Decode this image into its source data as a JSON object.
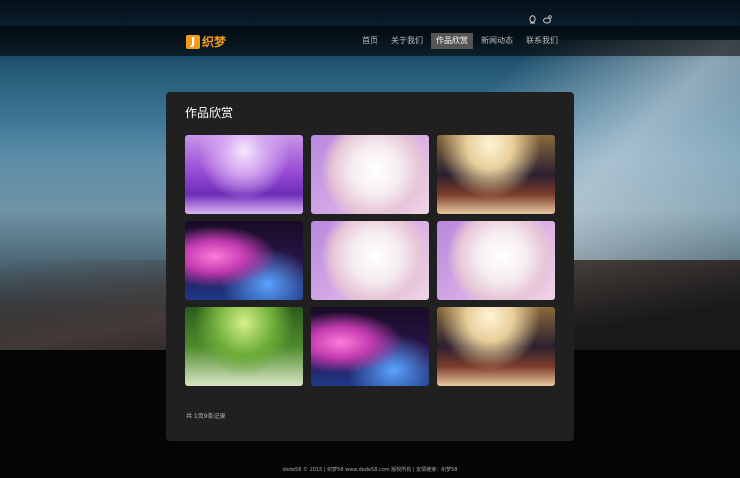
{
  "header": {
    "logo_mark": "J",
    "logo_text": "织梦",
    "icons": [
      "qq-icon",
      "weibo-icon"
    ]
  },
  "nav": {
    "items": [
      {
        "label": "首页",
        "active": false
      },
      {
        "label": "关于我们",
        "active": false
      },
      {
        "label": "作品欣赏",
        "active": true
      },
      {
        "label": "新闻动态",
        "active": false
      },
      {
        "label": "联系我们",
        "active": false
      }
    ]
  },
  "gallery": {
    "title": "作品欣赏",
    "items": [
      "purple-hall",
      "bridal-bouquet",
      "chandelier-hall",
      "stage-couple",
      "bridal-bouquet",
      "bridal-bouquet",
      "forest-couple",
      "stage-couple",
      "chandelier-hall"
    ]
  },
  "pagination": {
    "text": "共 1页9条记录"
  },
  "footer": {
    "text": "dede58 © 2015 | 织梦58 www.dede58.com 版权所有 | 友情链接：织梦58"
  },
  "colors": {
    "accent": "#f29a1a",
    "panel": "#202020",
    "nav_active": "#555555"
  }
}
